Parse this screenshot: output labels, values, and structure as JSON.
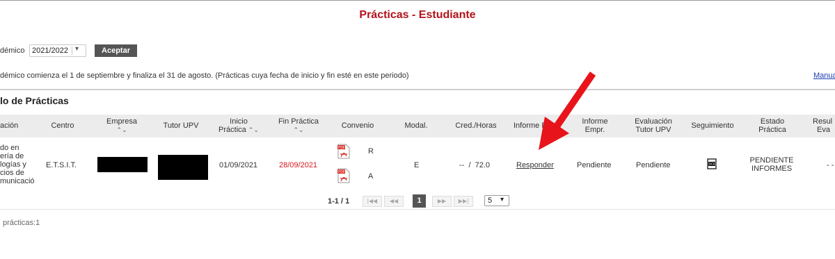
{
  "page": {
    "title": "Prácticas - Estudiante"
  },
  "filter": {
    "year_label": "démico",
    "year_value": "2021/2022",
    "accept_label": "Aceptar",
    "note": "démico comienza el 1 de septiembre y finaliza el 31 de agosto. (Prácticas cuya fecha de inicio y fin esté en este periodo)",
    "manual_link": "Manua"
  },
  "section": {
    "title": "lo de Prácticas"
  },
  "table": {
    "headers": {
      "titulacion": "ación",
      "centro": "Centro",
      "empresa": "Empresa",
      "tutor": "Tutor UPV",
      "inicio_1": "Inicio",
      "inicio_2": "Práctica",
      "fin": "Fin Práctica",
      "convenio": "Convenio",
      "modal": "Modal.",
      "cred": "Cred./Horas",
      "informe_est": "Informe E",
      "informe_empr_1": "Informe",
      "informe_empr_2": "Empr.",
      "eval_1": "Evaluación",
      "eval_2": "Tutor UPV",
      "seguimiento": "Seguimiento",
      "estado_1": "Estado",
      "estado_2": "Práctica",
      "result_1": "Resul",
      "result_2": "Eva"
    },
    "row": {
      "titulacion": [
        "do en",
        "ería de",
        "logías y",
        "cios de",
        "municació"
      ],
      "centro": "E.T.S.I.T.",
      "inicio": "01/09/2021",
      "fin": "28/09/2021",
      "convenio_r": "R",
      "convenio_a": "A",
      "modal": "E",
      "cred": "--  /  72.0",
      "informe_est": "Responder",
      "informe_empr": "Pendiente",
      "eval": "Pendiente",
      "estado_1": "PENDIENTE",
      "estado_2": "INFORMES",
      "result": "- -"
    }
  },
  "pager": {
    "count": "1-1 / 1",
    "current": "1",
    "page_size": "5"
  },
  "footer": {
    "total": "prácticas:1"
  },
  "colors": {
    "title": "#b3121a",
    "arrow": "#e8141c",
    "fin_date": "#d9141c"
  }
}
